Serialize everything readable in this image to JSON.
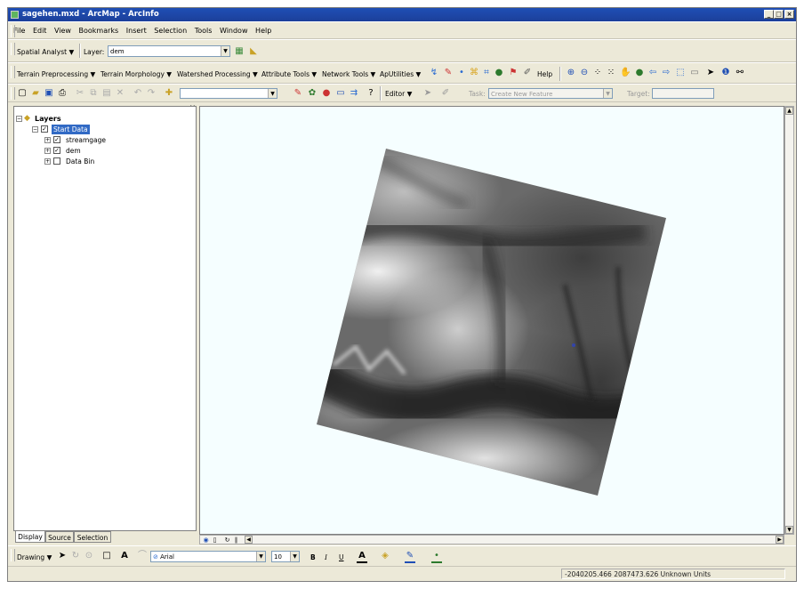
{
  "window": {
    "title": "sagehen.mxd - ArcMap - ArcInfo"
  },
  "menu": [
    "File",
    "Edit",
    "View",
    "Bookmarks",
    "Insert",
    "Selection",
    "Tools",
    "Window",
    "Help"
  ],
  "spatial_toolbar": {
    "spatial_analyst_label": "Spatial Analyst ▼",
    "layer_label": "Layer:",
    "layer_value": "dem"
  },
  "arc_hydro_toolbar": {
    "menus": [
      "Terrain Preprocessing ▼",
      "Terrain Morphology ▼",
      "Watershed Processing ▼",
      "Attribute Tools ▼",
      "Network Tools ▼",
      "ApUtilities ▼"
    ],
    "help_label": "Help"
  },
  "standard_toolbar": {
    "scale_value": "",
    "editor_label": "Editor ▼",
    "task_label": "Task:",
    "task_value": "Create New Feature",
    "target_label": "Target:"
  },
  "toc": {
    "root": "Layers",
    "group": "Start Data",
    "layers": [
      {
        "name": "streamgage",
        "checked": true
      },
      {
        "name": "dem",
        "checked": true
      },
      {
        "name": "Data Bin",
        "checked": false
      }
    ],
    "tabs": [
      "Display",
      "Source",
      "Selection"
    ]
  },
  "drawing_toolbar": {
    "drawing_label": "Drawing ▼",
    "font_name": "Arial",
    "font_size": "10",
    "bold": "B",
    "italic": "I",
    "underline": "U"
  },
  "status": {
    "coordinates": "-2040205.466  2087473.626 Unknown Units"
  },
  "colors": {
    "title_bar": "#1f4fb5",
    "chrome": "#ece9d8",
    "map_background": "#f5feff",
    "selection": "#316ac5"
  }
}
